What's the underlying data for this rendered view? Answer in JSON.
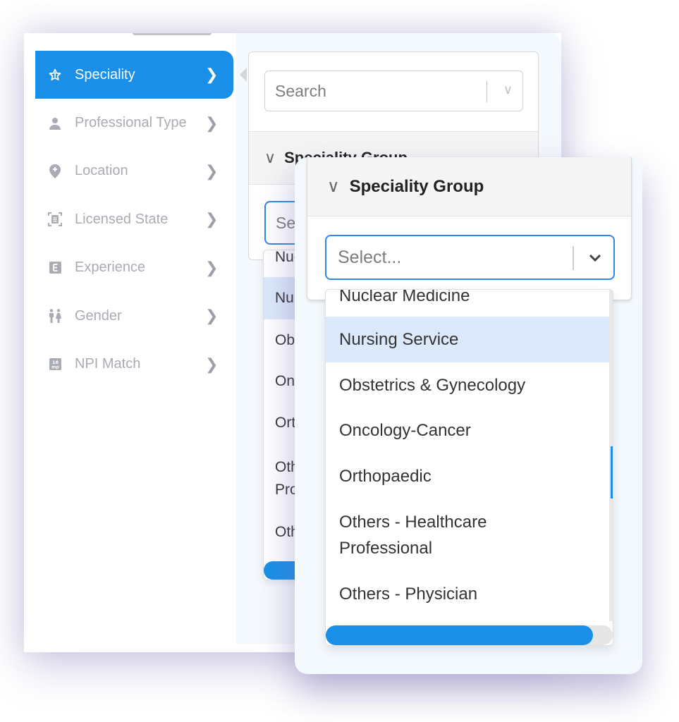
{
  "sidebar": {
    "items": [
      {
        "label": "Speciality",
        "icon": "star-icon",
        "active": true
      },
      {
        "label": "Professional Type",
        "icon": "person-icon",
        "active": false
      },
      {
        "label": "Location",
        "icon": "location-pin-icon",
        "active": false
      },
      {
        "label": "Licensed State",
        "icon": "document-scan-icon",
        "active": false
      },
      {
        "label": "Experience",
        "icon": "letter-e-icon",
        "active": false
      },
      {
        "label": "Gender",
        "icon": "gender-icon",
        "active": false
      },
      {
        "label": "NPI Match",
        "icon": "npi-badge-icon",
        "active": false
      }
    ]
  },
  "back_panel": {
    "search_placeholder": "Search",
    "group_title": "Speciality Group",
    "select_placeholder": "Select...",
    "options": [
      "Nuc",
      "Nur",
      "Obs",
      "Onc",
      "Ort",
      "Oth\nPro",
      "Oth"
    ]
  },
  "front_panel": {
    "group_title": "Speciality Group",
    "select_placeholder": "Select...",
    "options": [
      "Nuclear Medicine",
      "Nursing Service",
      "Obstetrics & Gynecology",
      "Oncology-Cancer",
      "Orthopaedic",
      "Others - Healthcare Professional",
      "Others - Physician"
    ],
    "highlighted_option": "Nursing Service",
    "horizontal_scroll_fraction": 0.93
  },
  "colors": {
    "accent": "#1a8fe8",
    "highlight": "#dce9fb",
    "card_bg": "#f4f9fd"
  }
}
